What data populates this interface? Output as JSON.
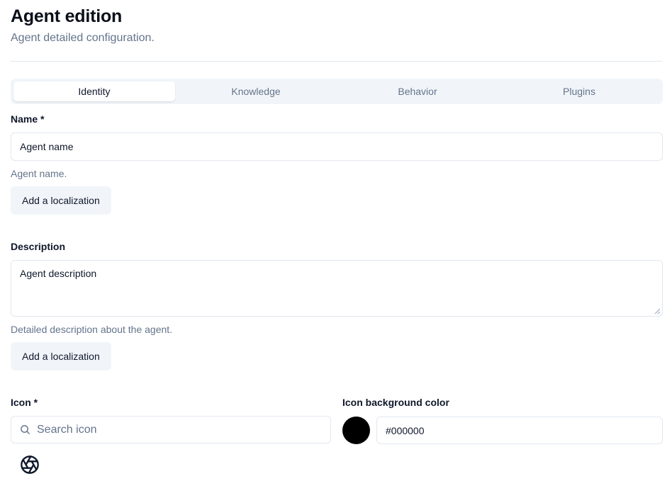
{
  "header": {
    "title": "Agent edition",
    "subtitle": "Agent detailed configuration."
  },
  "tabs": [
    {
      "label": "Identity",
      "active": true
    },
    {
      "label": "Knowledge",
      "active": false
    },
    {
      "label": "Behavior",
      "active": false
    },
    {
      "label": "Plugins",
      "active": false
    }
  ],
  "name": {
    "label": "Name *",
    "value": "Agent name",
    "hint": "Agent name.",
    "localization_button": "Add a localization"
  },
  "description": {
    "label": "Description",
    "value": "Agent description",
    "hint": "Detailed description about the agent.",
    "localization_button": "Add a localization"
  },
  "icon": {
    "label": "Icon *",
    "search_placeholder": "Search icon",
    "selected_icon": "aperture-icon"
  },
  "icon_background": {
    "label": "Icon background color",
    "value": "#000000",
    "swatch_color": "#000000"
  },
  "colors": {
    "muted_text": "#64748b",
    "border": "#e2e8f0",
    "tab_background": "#f1f5f9"
  }
}
